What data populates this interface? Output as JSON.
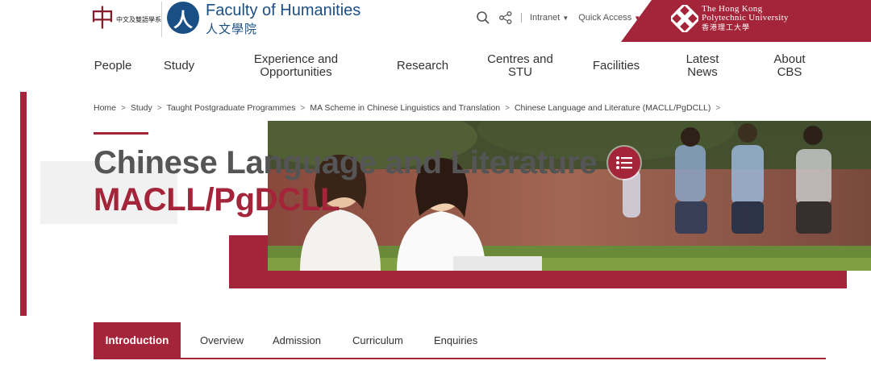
{
  "header": {
    "dept_logo_text": "中文及雙語學系",
    "faculty_title": "Faculty of Humanities",
    "faculty_subtitle": "人文學院",
    "tools": {
      "search_icon": "search-icon",
      "share_icon": "share-icon",
      "intranet_label": "Intranet",
      "quick_access_label": "Quick Access"
    },
    "university": {
      "line1": "The Hong Kong",
      "line2": "Polytechnic University",
      "line3": "香港理工大學"
    }
  },
  "nav": {
    "items": [
      {
        "label": "People"
      },
      {
        "label": "Study"
      },
      {
        "label": "Experience and Opportunities"
      },
      {
        "label": "Research"
      },
      {
        "label": "Centres and STU"
      },
      {
        "label": "Facilities"
      },
      {
        "label": "Latest News"
      },
      {
        "label": "About CBS"
      }
    ]
  },
  "breadcrumb": [
    "Home",
    "Study",
    "Taught Postgraduate Programmes",
    "MA Scheme in Chinese Linguistics and Translation",
    "Chinese Language and Literature (MACLL/PgDCLL)"
  ],
  "hero": {
    "title_line1": "Chinese Language and Literature",
    "title_line2": "MACLL/PgDCLL"
  },
  "tabs": [
    {
      "label": "Introduction",
      "active": true
    },
    {
      "label": "Overview"
    },
    {
      "label": "Admission"
    },
    {
      "label": "Curriculum"
    },
    {
      "label": "Enquiries"
    }
  ],
  "colors": {
    "brand_red": "#a4253a",
    "faculty_blue": "#1a4f86"
  }
}
